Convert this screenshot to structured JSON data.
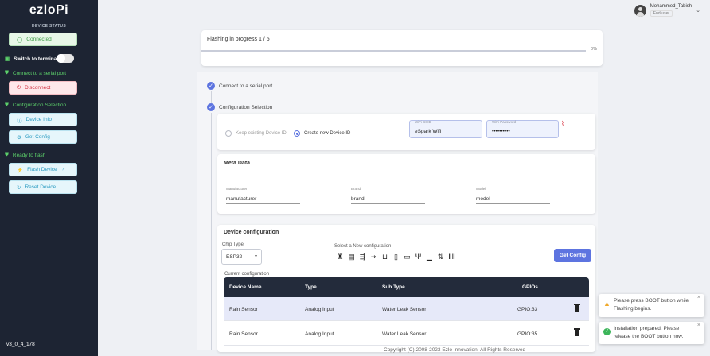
{
  "sidebar": {
    "logo": "ezloPi",
    "device_status_label": "DEVICE STATUS",
    "connected_label": "Connected",
    "switch_terminal_label": "Switch to terminal",
    "step_connect": "Connect to a serial port",
    "disconnect_label": "Disconnect",
    "step_config": "Configuration Selection",
    "device_info_label": "Device Info",
    "get_config_label": "Get Config",
    "step_flash": "Ready to flash",
    "flash_device_label": "Flash Device",
    "reset_device_label": "Reset Device",
    "version": "v3_0_4_178",
    "colors": {
      "bg": "#1d2433",
      "green": "#5ccf6a"
    }
  },
  "user": {
    "name": "Mohammed_Tabish",
    "role": "End-user"
  },
  "progress": {
    "title": "Flashing in progress 1 / 5",
    "percent_label": "0%",
    "value": 0
  },
  "steps": {
    "connect": "Connect to a serial port",
    "config": "Configuration Selection"
  },
  "config_selection": {
    "keep_existing": "Keep existing Device ID",
    "create_new": "Create new Device ID",
    "wifi_ssid_label": "WiFi SSID",
    "wifi_ssid_value": "eSpark Wifi",
    "wifi_password_label": "WiFi Password",
    "wifi_password_value": "••••••••••"
  },
  "meta": {
    "title": "Meta Data",
    "manufacturer_label": "Manufacturer",
    "manufacturer_value": "manufacturer",
    "brand_label": "Brand",
    "brand_value": "brand",
    "model_label": "Model",
    "model_value": "model"
  },
  "device_config": {
    "title": "Device configuration",
    "chip_type_label": "Chip Type",
    "chip_type_value": "ESP32",
    "new_config_label": "Select a New configuration",
    "get_config_button": "Get Config",
    "current_config_label": "Current configuration",
    "columns": [
      "Device Name",
      "Type",
      "Sub Type",
      "GPIOs"
    ],
    "rows": [
      {
        "name": "Rain Sensor",
        "type": "Analog Input",
        "subtype": "Water Leak Sensor",
        "gpio": "GPIO:33"
      },
      {
        "name": "Rain Sensor",
        "type": "Analog Input",
        "subtype": "Water Leak Sensor",
        "gpio": "GPIO:35"
      }
    ]
  },
  "footer": "Copyright (C) 2008-2023 Ezlo Innovation. All Rights Reserved",
  "toasts": [
    {
      "type": "warning",
      "text": "Please press BOOT button while Flashing begins."
    },
    {
      "type": "success",
      "text": "Installation prepared. Please release the BOOT button now."
    }
  ]
}
